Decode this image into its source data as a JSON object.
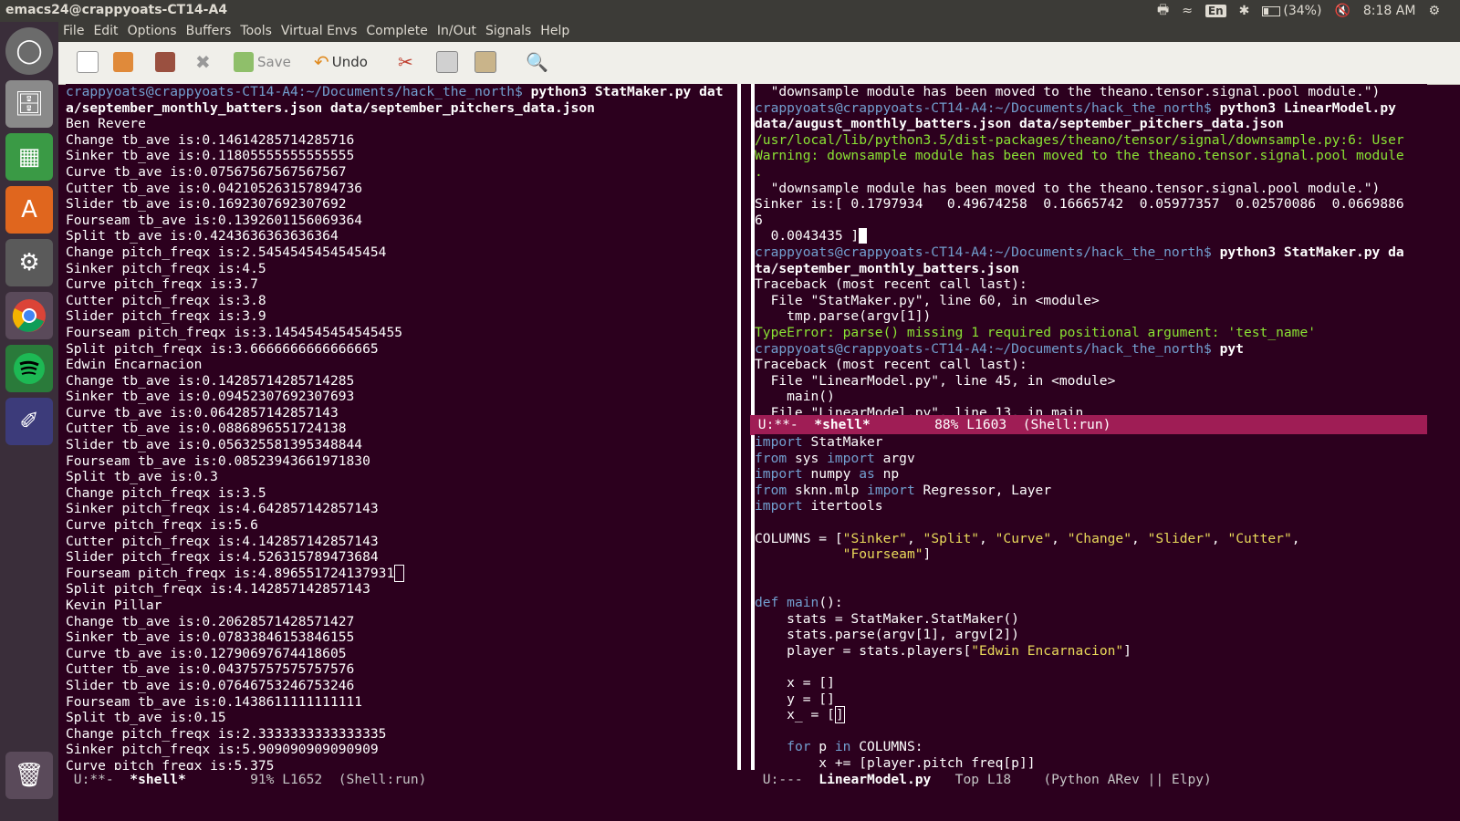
{
  "system": {
    "window_title": "emacs24@crappyoats-CT14-A4",
    "keyboard_layout": "En",
    "battery": "(34%)",
    "time": "8:18 AM"
  },
  "menu": [
    "File",
    "Edit",
    "Options",
    "Buffers",
    "Tools",
    "Virtual Envs",
    "Complete",
    "In/Out",
    "Signals",
    "Help"
  ],
  "toolbar": {
    "save_label": "Save",
    "undo_label": "Undo"
  },
  "left_pane": {
    "lines": [
      {
        "parts": [
          {
            "t": "crappyoats@crappyoats-CT14-A4:~/Documents/hack_the_north$ ",
            "c": "prompt"
          },
          {
            "t": "python3 StatMaker.py dat",
            "c": "cmd"
          }
        ]
      },
      {
        "parts": [
          {
            "t": "a/september_monthly_batters.json data/september_pitchers_data.json",
            "c": "cmd"
          }
        ]
      },
      {
        "parts": [
          {
            "t": "Ben Revere"
          }
        ]
      },
      {
        "parts": [
          {
            "t": "Change tb_ave is:0.14614285714285716"
          }
        ]
      },
      {
        "parts": [
          {
            "t": "Sinker tb_ave is:0.11805555555555555"
          }
        ]
      },
      {
        "parts": [
          {
            "t": "Curve tb_ave is:0.07567567567567567"
          }
        ]
      },
      {
        "parts": [
          {
            "t": "Cutter tb_ave is:0.042105263157894736"
          }
        ]
      },
      {
        "parts": [
          {
            "t": "Slider tb_ave is:0.1692307692307692"
          }
        ]
      },
      {
        "parts": [
          {
            "t": "Fourseam tb_ave is:0.1392601156069364"
          }
        ]
      },
      {
        "parts": [
          {
            "t": "Split tb_ave is:0.4243636363636364"
          }
        ]
      },
      {
        "parts": [
          {
            "t": "Change pitch_freqx is:2.5454545454545454"
          }
        ]
      },
      {
        "parts": [
          {
            "t": "Sinker pitch_freqx is:4.5"
          }
        ]
      },
      {
        "parts": [
          {
            "t": "Curve pitch_freqx is:3.7"
          }
        ]
      },
      {
        "parts": [
          {
            "t": "Cutter pitch_freqx is:3.8"
          }
        ]
      },
      {
        "parts": [
          {
            "t": "Slider pitch_freqx is:3.9"
          }
        ]
      },
      {
        "parts": [
          {
            "t": "Fourseam pitch_freqx is:3.1454545454545455"
          }
        ]
      },
      {
        "parts": [
          {
            "t": "Split pitch_freqx is:3.6666666666666665"
          }
        ]
      },
      {
        "parts": [
          {
            "t": "Edwin Encarnacion"
          }
        ]
      },
      {
        "parts": [
          {
            "t": "Change tb_ave is:0.14285714285714285"
          }
        ]
      },
      {
        "parts": [
          {
            "t": "Sinker tb_ave is:0.09452307692307693"
          }
        ]
      },
      {
        "parts": [
          {
            "t": "Curve tb_ave is:0.0642857142857143"
          }
        ]
      },
      {
        "parts": [
          {
            "t": "Cutter tb_ave is:0.0886896551724138"
          }
        ]
      },
      {
        "parts": [
          {
            "t": "Slider tb_ave is:0.056325581395348844"
          }
        ]
      },
      {
        "parts": [
          {
            "t": "Fourseam tb_ave is:0.08523943661971830"
          }
        ]
      },
      {
        "parts": [
          {
            "t": "Split tb_ave is:0.3"
          }
        ]
      },
      {
        "parts": [
          {
            "t": "Change pitch_freqx is:3.5"
          }
        ]
      },
      {
        "parts": [
          {
            "t": "Sinker pitch_freqx is:4.642857142857143"
          }
        ]
      },
      {
        "parts": [
          {
            "t": "Curve pitch_freqx is:5.6"
          }
        ]
      },
      {
        "parts": [
          {
            "t": "Cutter pitch_freqx is:4.142857142857143"
          }
        ]
      },
      {
        "parts": [
          {
            "t": "Slider pitch_freqx is:4.526315789473684"
          }
        ]
      },
      {
        "parts": [
          {
            "t": "Fourseam pitch_freqx is:4.896551724137931"
          },
          {
            "t": " ",
            "c": "cursor-box"
          }
        ]
      },
      {
        "parts": [
          {
            "t": "Split pitch_freqx is:4.142857142857143"
          }
        ]
      },
      {
        "parts": [
          {
            "t": "Kevin Pillar"
          }
        ]
      },
      {
        "parts": [
          {
            "t": "Change tb_ave is:0.20628571428571427"
          }
        ]
      },
      {
        "parts": [
          {
            "t": "Sinker tb_ave is:0.07833846153846155"
          }
        ]
      },
      {
        "parts": [
          {
            "t": "Curve tb_ave is:0.12790697674418605"
          }
        ]
      },
      {
        "parts": [
          {
            "t": "Cutter tb_ave is:0.04375757575757576"
          }
        ]
      },
      {
        "parts": [
          {
            "t": "Slider tb_ave is:0.07646753246753246"
          }
        ]
      },
      {
        "parts": [
          {
            "t": "Fourseam tb_ave is:0.1438611111111111"
          }
        ]
      },
      {
        "parts": [
          {
            "t": "Split tb_ave is:0.15"
          }
        ]
      },
      {
        "parts": [
          {
            "t": "Change pitch_freqx is:2.3333333333333335"
          }
        ]
      },
      {
        "parts": [
          {
            "t": "Sinker pitch_freqx is:5.909090909090909"
          }
        ]
      },
      {
        "parts": [
          {
            "t": "Curve pitch_freqx is:5.375"
          }
        ]
      }
    ]
  },
  "right_shell": {
    "lines": [
      {
        "parts": [
          {
            "t": "  \"downsample module has been moved to the theano.tensor.signal.pool module.\")"
          }
        ]
      },
      {
        "parts": [
          {
            "t": "crappyoats@crappyoats-CT14-A4:~/Documents/hack_the_north$ ",
            "c": "prompt"
          },
          {
            "t": "python3 LinearModel.py",
            "c": "cmd"
          }
        ]
      },
      {
        "parts": [
          {
            "t": "data/august_monthly_batters.json data/september_pitchers_data.json",
            "c": "cmd"
          }
        ]
      },
      {
        "parts": [
          {
            "t": "/usr/local/lib/python3.5/dist-packages/theano/tensor/signal/downsample.py:6: User",
            "c": "green"
          }
        ]
      },
      {
        "parts": [
          {
            "t": "Warning: downsample module has been moved to the theano.tensor.signal.pool module",
            "c": "green"
          }
        ]
      },
      {
        "parts": [
          {
            "t": ".",
            "c": "green"
          }
        ]
      },
      {
        "parts": [
          {
            "t": "  \"downsample module has been moved to the theano.tensor.signal.pool module.\")"
          }
        ]
      },
      {
        "parts": [
          {
            "t": "Sinker is:[ 0.1797934   0.49674258  0.16665742  0.05977357  0.02570086  0.0669886"
          }
        ]
      },
      {
        "parts": [
          {
            "t": "6"
          }
        ]
      },
      {
        "parts": [
          {
            "t": "  0.0043435 ]"
          },
          {
            "t": " ",
            "c": "cursor"
          }
        ]
      },
      {
        "parts": [
          {
            "t": "crappyoats@crappyoats-CT14-A4:~/Documents/hack_the_north$ ",
            "c": "prompt"
          },
          {
            "t": "python3 StatMaker.py da",
            "c": "cmd"
          }
        ]
      },
      {
        "parts": [
          {
            "t": "ta/september_monthly_batters.json",
            "c": "cmd"
          }
        ]
      },
      {
        "parts": [
          {
            "t": "Traceback (most recent call last):"
          }
        ]
      },
      {
        "parts": [
          {
            "t": "  File \"StatMaker.py\", line 60, in <module>"
          }
        ]
      },
      {
        "parts": [
          {
            "t": "    tmp.parse(argv[1])"
          }
        ]
      },
      {
        "parts": [
          {
            "t": "TypeError: parse() missing 1 required positional argument: 'test_name'",
            "c": "green"
          }
        ]
      },
      {
        "parts": [
          {
            "t": "crappyoats@crappyoats-CT14-A4:~/Documents/hack_the_north$ ",
            "c": "prompt"
          },
          {
            "t": "pyt",
            "c": "cmd"
          }
        ]
      },
      {
        "parts": [
          {
            "t": "Traceback (most recent call last):"
          }
        ]
      },
      {
        "parts": [
          {
            "t": "  File \"LinearModel.py\", line 45, in <module>"
          }
        ]
      },
      {
        "parts": [
          {
            "t": "    main()"
          }
        ]
      },
      {
        "parts": [
          {
            "t": "  File \"LinearModel.py\", line 13, in main"
          }
        ]
      }
    ]
  },
  "right_code": {
    "lines": [
      {
        "parts": [
          {
            "t": "import",
            "c": "kw"
          },
          {
            "t": " StatMaker"
          }
        ]
      },
      {
        "parts": [
          {
            "t": "from",
            "c": "kw"
          },
          {
            "t": " sys "
          },
          {
            "t": "import",
            "c": "kw"
          },
          {
            "t": " argv"
          }
        ]
      },
      {
        "parts": [
          {
            "t": "import",
            "c": "kw"
          },
          {
            "t": " numpy "
          },
          {
            "t": "as",
            "c": "kw"
          },
          {
            "t": " np"
          }
        ]
      },
      {
        "parts": [
          {
            "t": "from",
            "c": "kw"
          },
          {
            "t": " sknn.mlp "
          },
          {
            "t": "import",
            "c": "kw"
          },
          {
            "t": " Regressor, Layer"
          }
        ]
      },
      {
        "parts": [
          {
            "t": "import",
            "c": "kw"
          },
          {
            "t": " itertools"
          }
        ]
      },
      {
        "parts": [
          {
            "t": ""
          }
        ]
      },
      {
        "parts": [
          {
            "t": "COLUMNS = ["
          },
          {
            "t": "\"Sinker\"",
            "c": "str"
          },
          {
            "t": ", "
          },
          {
            "t": "\"Split\"",
            "c": "str"
          },
          {
            "t": ", "
          },
          {
            "t": "\"Curve\"",
            "c": "str"
          },
          {
            "t": ", "
          },
          {
            "t": "\"Change\"",
            "c": "str"
          },
          {
            "t": ", "
          },
          {
            "t": "\"Slider\"",
            "c": "str"
          },
          {
            "t": ", "
          },
          {
            "t": "\"Cutter\"",
            "c": "str"
          },
          {
            "t": ","
          }
        ]
      },
      {
        "parts": [
          {
            "t": "           "
          },
          {
            "t": "\"Fourseam\"",
            "c": "str"
          },
          {
            "t": "]"
          }
        ]
      },
      {
        "parts": [
          {
            "t": ""
          }
        ]
      },
      {
        "parts": [
          {
            "t": ""
          }
        ]
      },
      {
        "parts": [
          {
            "t": "def",
            "c": "kw"
          },
          {
            "t": " "
          },
          {
            "t": "main",
            "c": "fn"
          },
          {
            "t": "():"
          }
        ]
      },
      {
        "parts": [
          {
            "t": "    stats = StatMaker.StatMaker()"
          }
        ]
      },
      {
        "parts": [
          {
            "t": "    stats.parse(argv[1], argv[2])"
          }
        ]
      },
      {
        "parts": [
          {
            "t": "    player = stats.players["
          },
          {
            "t": "\"Edwin Encarnacion\"",
            "c": "str"
          },
          {
            "t": "]"
          }
        ]
      },
      {
        "parts": [
          {
            "t": ""
          }
        ]
      },
      {
        "parts": [
          {
            "t": "    x = []"
          }
        ]
      },
      {
        "parts": [
          {
            "t": "    y = []"
          }
        ]
      },
      {
        "parts": [
          {
            "t": "    x_ = ["
          },
          {
            "t": "]",
            "c": "cursor-box"
          }
        ]
      },
      {
        "parts": [
          {
            "t": ""
          }
        ]
      },
      {
        "parts": [
          {
            "t": "    "
          },
          {
            "t": "for",
            "c": "kw"
          },
          {
            "t": " p "
          },
          {
            "t": "in",
            "c": "kw"
          },
          {
            "t": " COLUMNS:"
          }
        ]
      },
      {
        "parts": [
          {
            "t": "        x += [player.pitch_freq[p]]"
          }
        ]
      }
    ]
  },
  "modelines": {
    "right_active": {
      "status": " U:**-  ",
      "buffer": "*shell*",
      "pos": "        88% L1603  ",
      "mode": "(Shell:run)"
    },
    "left": {
      "status": " U:**-  ",
      "buffer": "*shell*",
      "pos": "        91% L1652  ",
      "mode": "(Shell:run)"
    },
    "right": {
      "status": " U:---  ",
      "buffer": "LinearModel.py",
      "pos": "   Top L18    ",
      "mode": "(Python ARev || Elpy)"
    }
  },
  "colors": {
    "background": "#2c001e",
    "prompt": "#729fcf",
    "warning": "#8ae234",
    "string": "#e9d95a",
    "active_modeline": "#9f1d55"
  },
  "launcher_icons": [
    "ubuntu-dash-icon",
    "files-icon",
    "spreadsheet-icon",
    "software-center-icon",
    "system-settings-icon",
    "chrome-icon",
    "spotify-icon",
    "emacs-icon",
    "trash-icon"
  ]
}
